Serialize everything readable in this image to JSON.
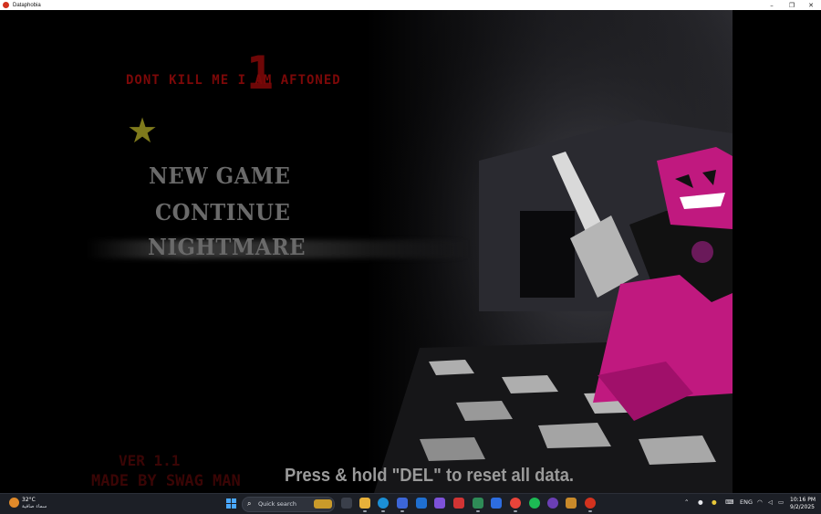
{
  "window": {
    "title": "Dataphobia",
    "minimize": "–",
    "restore": "❐",
    "close": "✕"
  },
  "game": {
    "title_text": "DONT KILL ME I AM AFTONED",
    "big_number": "1",
    "star_icon": "star-icon",
    "menu": [
      {
        "label": "NEW GAME"
      },
      {
        "label": "CONTINUE"
      },
      {
        "label": "NIGHTMARE"
      }
    ],
    "version": "VER 1.1",
    "credit": "MADE BY SWAG MAN",
    "hint": "Press & hold \"DEL\" to reset all data."
  },
  "taskbar": {
    "weather": {
      "temp": "32°C",
      "desc": "سماء صافية"
    },
    "search_placeholder": "Quick search",
    "tray": {
      "language": "ENG"
    },
    "clock": {
      "time": "10:16 PM",
      "date": "9/2/2025"
    }
  },
  "colors": {
    "title_red": "#7c0808",
    "accent_magenta": "#c0197f",
    "menu_gray": "#6a6a6a"
  }
}
